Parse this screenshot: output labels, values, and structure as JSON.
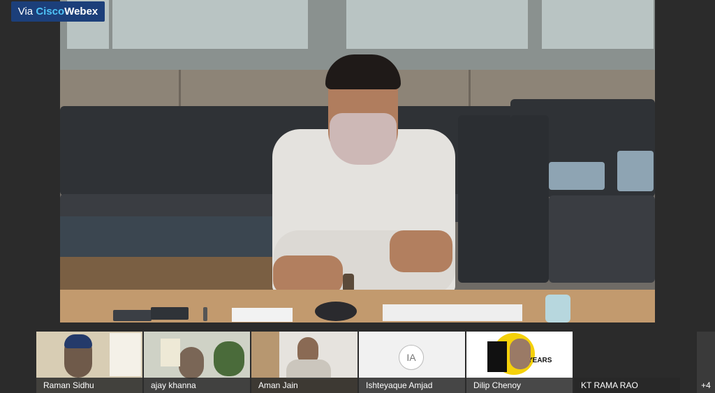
{
  "badge": {
    "via": "Via",
    "cisco": "Cisco",
    "webex": "Webex"
  },
  "participants": [
    {
      "name": "Raman Sidhu"
    },
    {
      "name": "ajay khanna"
    },
    {
      "name": "Aman Jain"
    },
    {
      "name": "Ishteyaque Amjad",
      "initials": "IA"
    },
    {
      "name": "Dilip Chenoy",
      "logo_text": "YEARS"
    },
    {
      "name": "KT RAMA RAO"
    }
  ],
  "overflow_count": "+4"
}
